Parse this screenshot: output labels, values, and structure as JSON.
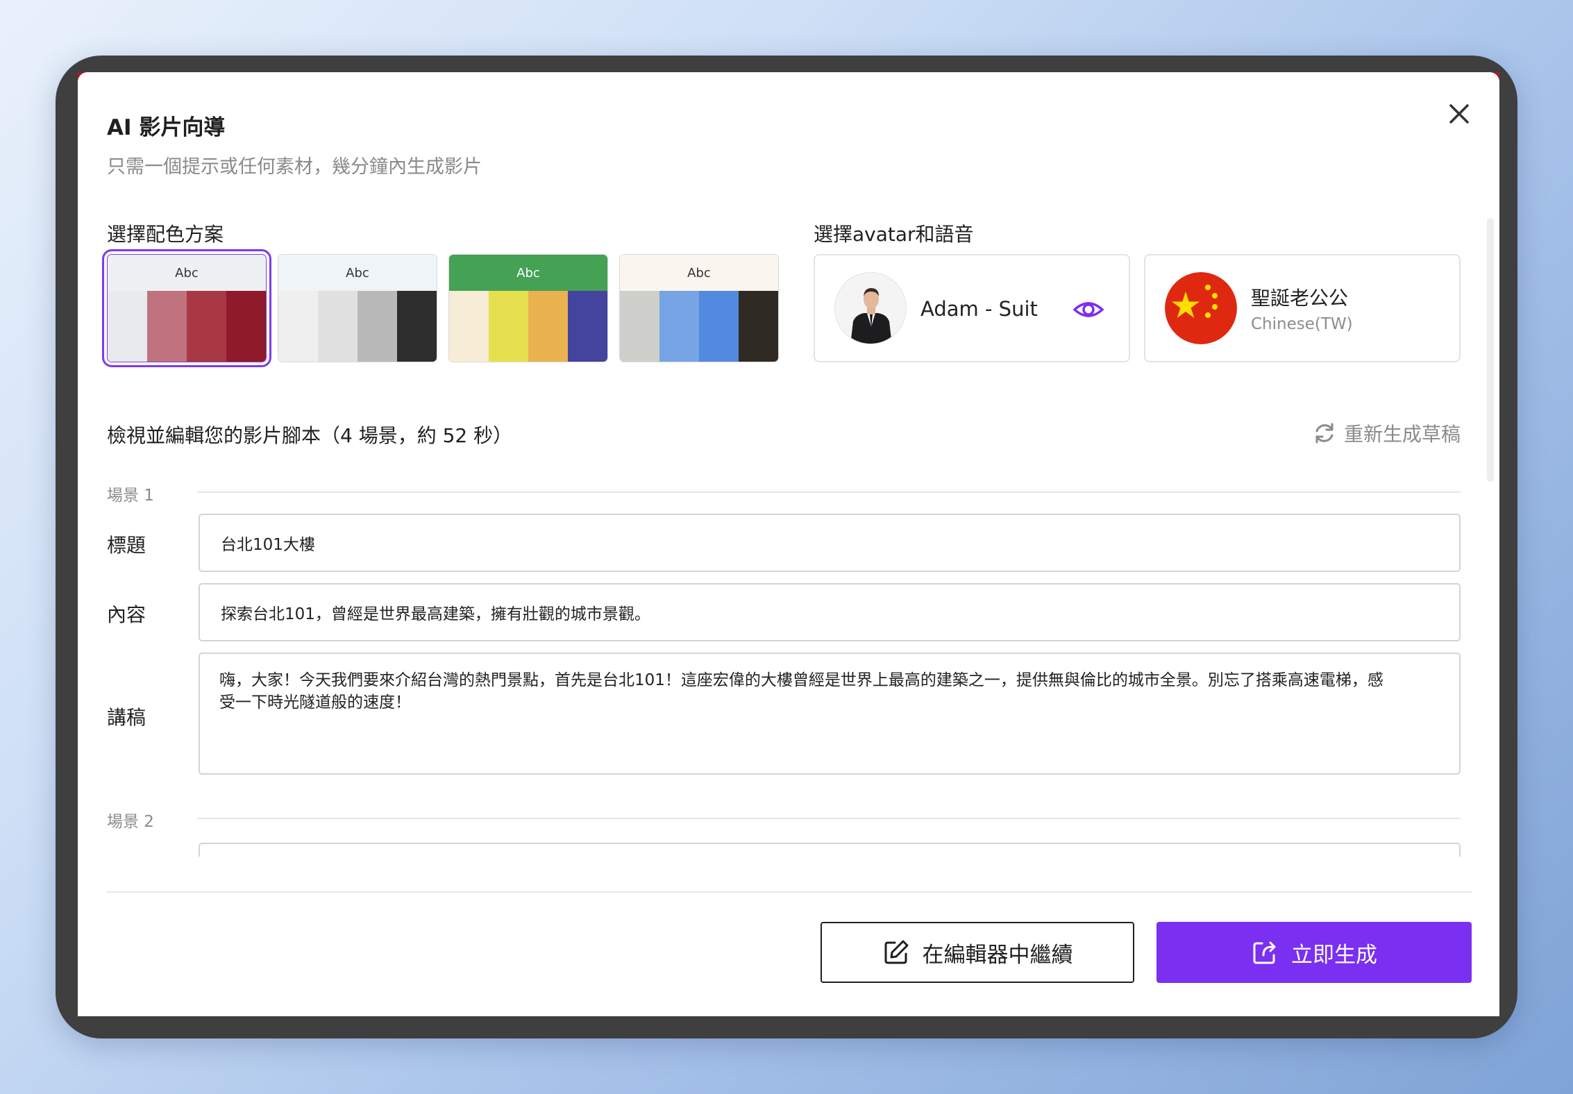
{
  "modal": {
    "title": "AI 影片向導",
    "subtitle": "只需一個提示或任何素材，幾分鐘內生成影片"
  },
  "color_scheme": {
    "label": "選擇配色方案",
    "palettes": [
      {
        "label": "Abc",
        "header_color": "#eef1f4",
        "header_text_color": "#333333",
        "colors": [
          "#e8eaed",
          "#c0727f",
          "#a93845",
          "#8f1a2a"
        ],
        "selected": true
      },
      {
        "label": "Abc",
        "header_color": "#eff4f8",
        "header_text_color": "#333333",
        "colors": [
          "#efefef",
          "#e1e1e1",
          "#b9b9b9",
          "#2e2e2e"
        ],
        "selected": false
      },
      {
        "label": "Abc",
        "header_color": "#45a153",
        "header_text_color": "#ffffff",
        "colors": [
          "#f7ecd5",
          "#e6e04f",
          "#e9b24f",
          "#44439d"
        ],
        "selected": false
      },
      {
        "label": "Abc",
        "header_color": "#faf6ef",
        "header_text_color": "#333333",
        "colors": [
          "#cfd0cb",
          "#76a4e4",
          "#528ae0",
          "#302a24"
        ],
        "selected": false
      }
    ]
  },
  "avatar_voice": {
    "label": "選擇avatar和語音",
    "avatar": {
      "name": "Adam - Suit",
      "icon": "eye-icon"
    },
    "voice": {
      "name": "聖誕老公公",
      "language": "Chinese(TW)",
      "icon": "china-flag-icon"
    }
  },
  "script": {
    "title": "檢視並編輯您的影片腳本（4 場景，約 52 秒）",
    "regenerate_label": "重新生成草稿",
    "scenes": [
      {
        "label": "場景 1",
        "title_label": "標題",
        "title_value": "台北101大樓",
        "content_label": "內容",
        "content_value": "探索台北101，曾經是世界最高建築，擁有壯觀的城市景觀。",
        "speech_label": "講稿",
        "speech_line1": "嗨，大家！今天我們要來介紹台灣的熱門景點，首先是台北101！這座宏偉的大樓曾經是世界上最高的建築之一，提供無與倫比的城市全景。別忘了搭乘高速電梯，感",
        "speech_line2": "受一下時光隧道般的速度！"
      },
      {
        "label": "場景 2"
      }
    ]
  },
  "footer": {
    "continue_label": "在編輯器中繼續",
    "generate_label": "立即生成"
  },
  "colors": {
    "accent": "#7b2ff0",
    "selected_outline": "#7b3bf0"
  }
}
